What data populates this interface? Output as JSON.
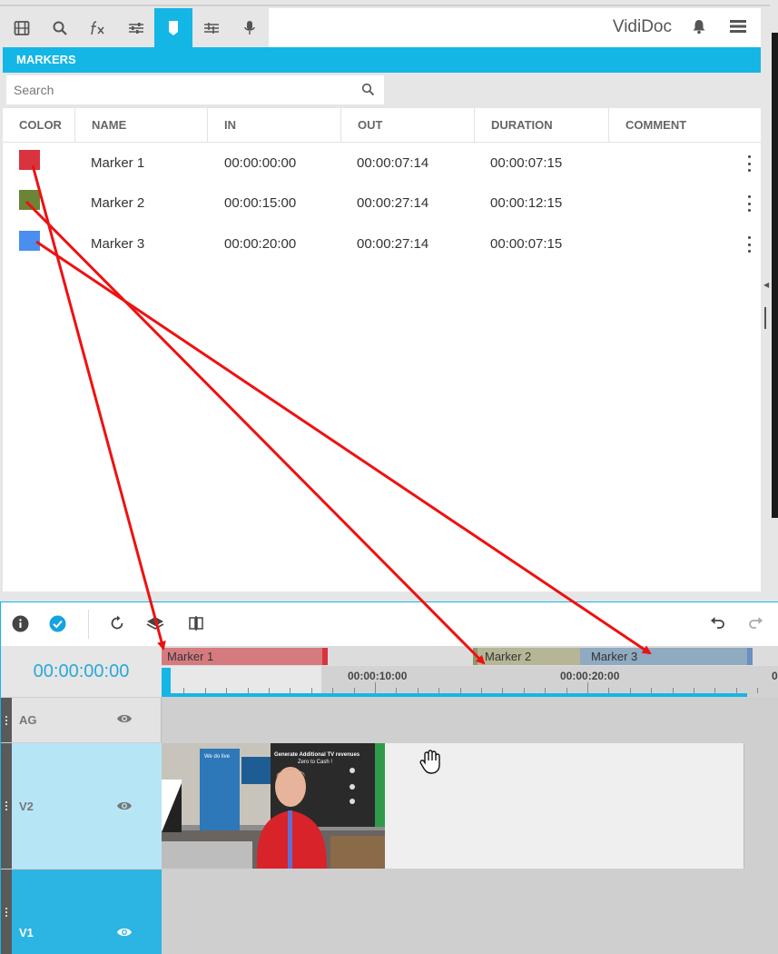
{
  "app": {
    "name": "VidiDoc"
  },
  "toolbar": {
    "tools": [
      "film-icon",
      "search-icon",
      "fx-icon",
      "sliders-icon",
      "marker-icon",
      "tracks-icon",
      "mic-icon"
    ],
    "active_tool": "marker-icon"
  },
  "panel": {
    "title": "MARKERS"
  },
  "search": {
    "placeholder": "Search",
    "value": ""
  },
  "table": {
    "columns": [
      "COLOR",
      "NAME",
      "IN",
      "OUT",
      "DURATION",
      "COMMENT"
    ],
    "rows": [
      {
        "color": "#d9333f",
        "name": "Marker 1",
        "in": "00:00:00:00",
        "out": "00:00:07:14",
        "duration": "00:00:07:15",
        "comment": ""
      },
      {
        "color": "#6b8436",
        "name": "Marker 2",
        "in": "00:00:15:00",
        "out": "00:00:27:14",
        "duration": "00:00:12:15",
        "comment": ""
      },
      {
        "color": "#4a8ff0",
        "name": "Marker 3",
        "in": "00:00:20:00",
        "out": "00:00:27:14",
        "duration": "00:00:07:15",
        "comment": ""
      }
    ]
  },
  "timeline": {
    "timecode": "00:00:00:00",
    "ruler_labels": [
      "00:00:10:00",
      "00:00:20:00",
      "0"
    ],
    "markers": [
      {
        "label": "Marker 1",
        "color": "#d57b80",
        "edge": "#d9333f"
      },
      {
        "label": "Marker 2",
        "color": "#b6b596",
        "edge": "#8b9a6a"
      },
      {
        "label": "Marker 3",
        "color": "#8faac1",
        "edge": "#6a8fc0"
      }
    ],
    "tracks": [
      {
        "name": "AG"
      },
      {
        "name": "V2"
      },
      {
        "name": "V1"
      }
    ],
    "clip": {
      "banner": "Generate Additional TV revenues",
      "banner_sub": "Zero to Cash !",
      "tagline": "We do live"
    }
  },
  "colors": {
    "accent": "#14b6e6",
    "annotation_arrow": "#ee1111"
  }
}
